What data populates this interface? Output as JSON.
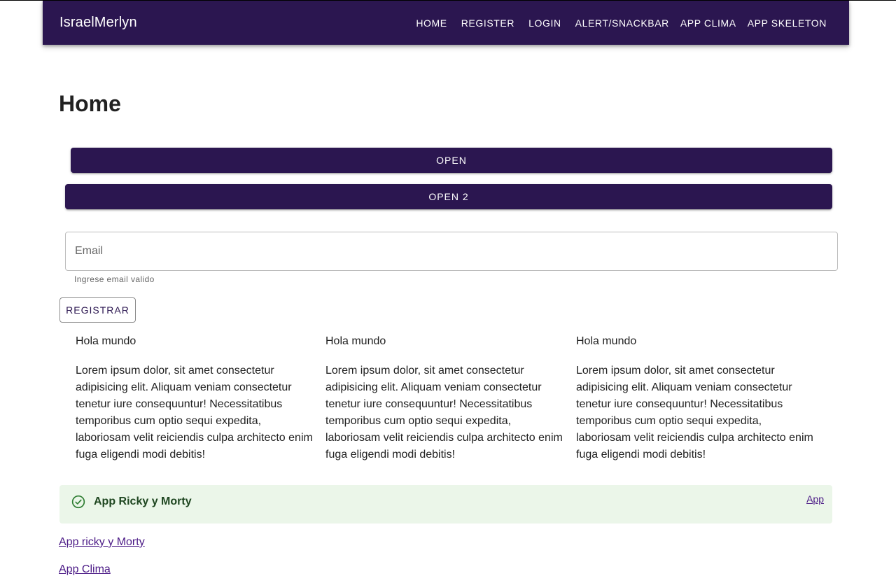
{
  "appbar": {
    "brand": "IsraelMerlyn",
    "nav": [
      "HOME",
      "REGISTER",
      "LOGIN",
      "ALERT/SNACKBAR",
      "APP CLIMA",
      "APP SKELETON"
    ],
    "color": "#2b1650"
  },
  "main": {
    "title": "Home",
    "open_button": "OPEN",
    "open2_button": "OPEN 2",
    "email": {
      "placeholder": "Email",
      "value": "",
      "helper": "Ingrese email valido"
    },
    "register_button": "REGISTRAR",
    "columns": [
      {
        "title": "Hola mundo",
        "text": "Lorem ipsum dolor, sit amet consectetur adipisicing elit. Aliquam veniam consectetur tenetur iure consequuntur! Necessitatibus temporibus cum optio sequi expedita, laboriosam velit reiciendis culpa architecto enim fuga eligendi modi debitis!"
      },
      {
        "title": "Hola mundo",
        "text": "Lorem ipsum dolor, sit amet consectetur adipisicing elit. Aliquam veniam consectetur tenetur iure consequuntur! Necessitatibus temporibus cum optio sequi expedita, laboriosam velit reiciendis culpa architecto enim fuga eligendi modi debitis!"
      },
      {
        "title": "Hola mundo",
        "text": "Lorem ipsum dolor, sit amet consectetur adipisicing elit. Aliquam veniam consectetur tenetur iure consequuntur! Necessitatibus temporibus cum optio sequi expedita, laboriosam velit reiciendis culpa architecto enim fuga eligendi modi debitis!"
      }
    ],
    "alert": {
      "title": "App Ricky y Morty",
      "action_link": "App",
      "icon": "check-circle-icon",
      "background": "#ebf6e9"
    },
    "links": [
      "App ricky y Morty",
      "App Clima"
    ]
  }
}
